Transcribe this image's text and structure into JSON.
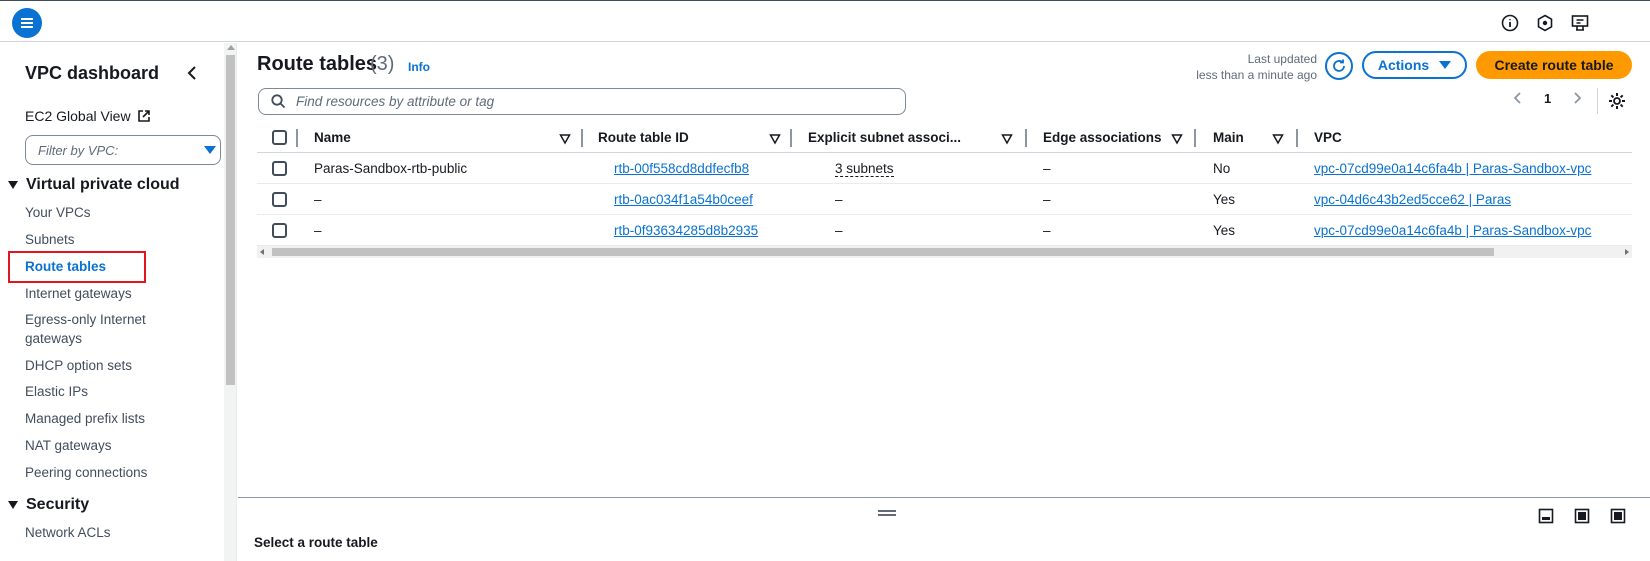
{
  "topbar": {
    "menu_icon": "hamburger-menu-icon",
    "right_icons": [
      "info-icon",
      "notifications-icon",
      "feedback-icon"
    ]
  },
  "sidebar": {
    "title": "VPC dashboard",
    "ec2_global_view": "EC2 Global View",
    "filter_placeholder": "Filter by VPC:",
    "sections": [
      {
        "label": "Virtual private cloud",
        "items": [
          "Your VPCs",
          "Subnets",
          "Route tables",
          "Internet gateways",
          "Egress-only Internet gateways",
          "DHCP option sets",
          "Elastic IPs",
          "Managed prefix lists",
          "NAT gateways",
          "Peering connections"
        ]
      },
      {
        "label": "Security",
        "items": [
          "Network ACLs"
        ]
      }
    ],
    "active_item": "Route tables"
  },
  "main": {
    "title": "Route tables",
    "count": "(3)",
    "info": "Info",
    "last_updated_label": "Last updated",
    "last_updated_value": "less than a minute ago",
    "actions_label": "Actions",
    "create_label": "Create route table",
    "search_placeholder": "Find resources by attribute or tag",
    "page_number": "1"
  },
  "table": {
    "columns": [
      "Name",
      "Route table ID",
      "Explicit subnet associ...",
      "Edge associations",
      "Main",
      "VPC"
    ],
    "rows": [
      {
        "name": "Paras-Sandbox-rtb-public",
        "route_table_id": "rtb-00f558cd8ddfecfb8",
        "explicit_subnet": "3 subnets",
        "edge": "–",
        "main": "No",
        "vpc": "vpc-07cd99e0a14c6fa4b | Paras-Sandbox-vpc"
      },
      {
        "name": "–",
        "route_table_id": "rtb-0ac034f1a54b0ceef",
        "explicit_subnet": "–",
        "edge": "–",
        "main": "Yes",
        "vpc": "vpc-04d6c43b2ed5cce62 | Paras"
      },
      {
        "name": "–",
        "route_table_id": "rtb-0f93634285d8b2935",
        "explicit_subnet": "–",
        "edge": "–",
        "main": "Yes",
        "vpc": "vpc-07cd99e0a14c6fa4b | Paras-Sandbox-vpc"
      }
    ]
  },
  "split_panel": {
    "title": "Select a route table"
  },
  "colors": {
    "accent": "#0972d3",
    "primary_button": "#ff9900",
    "highlight_box": "#e0161e"
  }
}
